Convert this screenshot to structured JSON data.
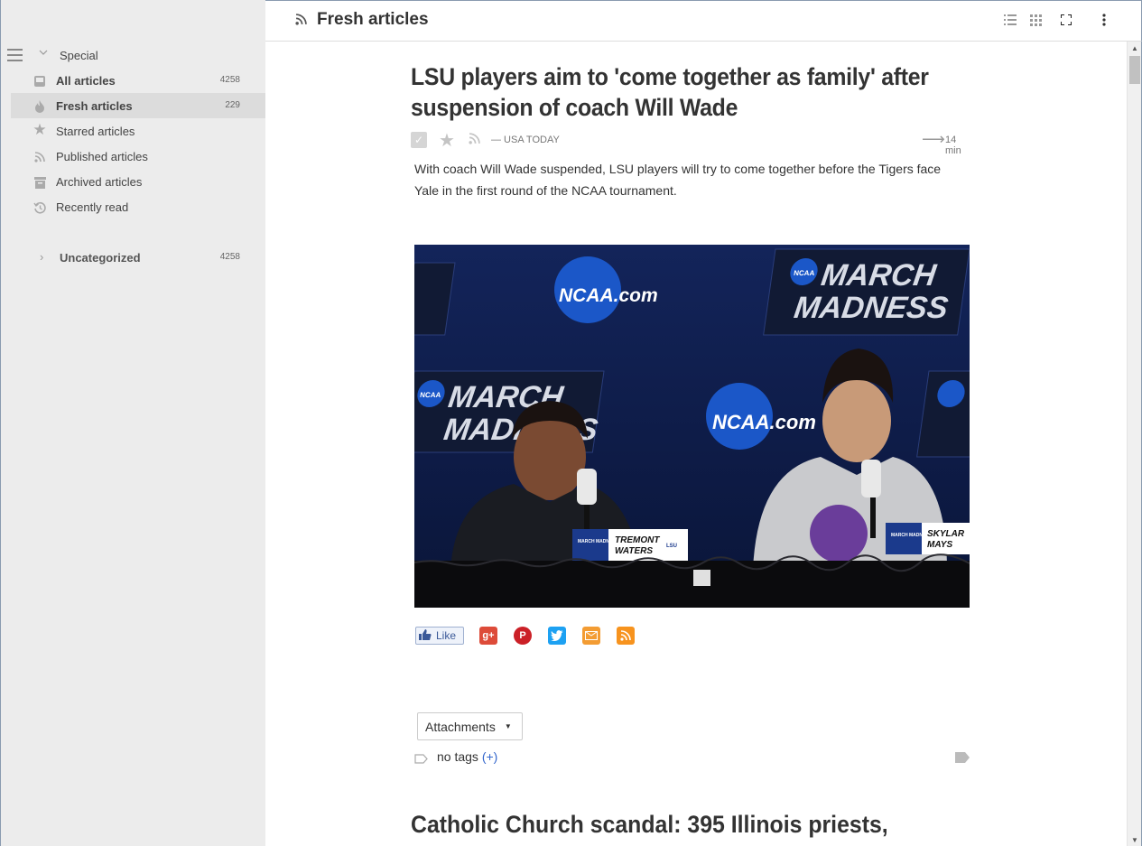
{
  "sidebar": {
    "special": {
      "label": "Special"
    },
    "items": [
      {
        "label": "All articles",
        "count": "4258",
        "icon": "inbox-icon",
        "bold": true
      },
      {
        "label": "Fresh articles",
        "count": "229",
        "icon": "fire-icon",
        "bold": true,
        "selected": true
      },
      {
        "label": "Starred articles",
        "count": "",
        "icon": "star-icon"
      },
      {
        "label": "Published articles",
        "count": "",
        "icon": "rss-icon"
      },
      {
        "label": "Archived articles",
        "count": "",
        "icon": "archive-icon"
      },
      {
        "label": "Recently read",
        "count": "",
        "icon": "history-icon"
      }
    ],
    "category": {
      "label": "Uncategorized",
      "count": "4258"
    }
  },
  "header": {
    "title": "Fresh articles"
  },
  "article": {
    "title": "LSU players aim to 'come together as family' after suspension of coach Will Wade",
    "source": "— USA TODAY",
    "reading_time": "14 min",
    "summary": "With coach Will Wade suspended, LSU players will try to come together before the Tigers face Yale in the first round of the NCAA tournament.",
    "image": {
      "backdrop_texts": [
        "NCAA.com",
        "MARCH",
        "MADNESS",
        "NCAA"
      ],
      "nameplate_left": [
        "TREMONT",
        "WATERS"
      ],
      "nameplate_right": [
        "SKYLAR",
        "MAYS"
      ],
      "nameplate_small": "MARCH MADNESS",
      "school": "LSU"
    },
    "like_label": "Like",
    "attachments_label": "Attachments",
    "tags_label": "no tags",
    "tags_add": "(+)"
  },
  "next_article": {
    "title": "Catholic Church scandal: 395 Illinois priests,"
  },
  "colors": {
    "accent": "#3366cc",
    "selected_bg": "#dcdcdc",
    "sidebar_bg": "#ececec"
  }
}
